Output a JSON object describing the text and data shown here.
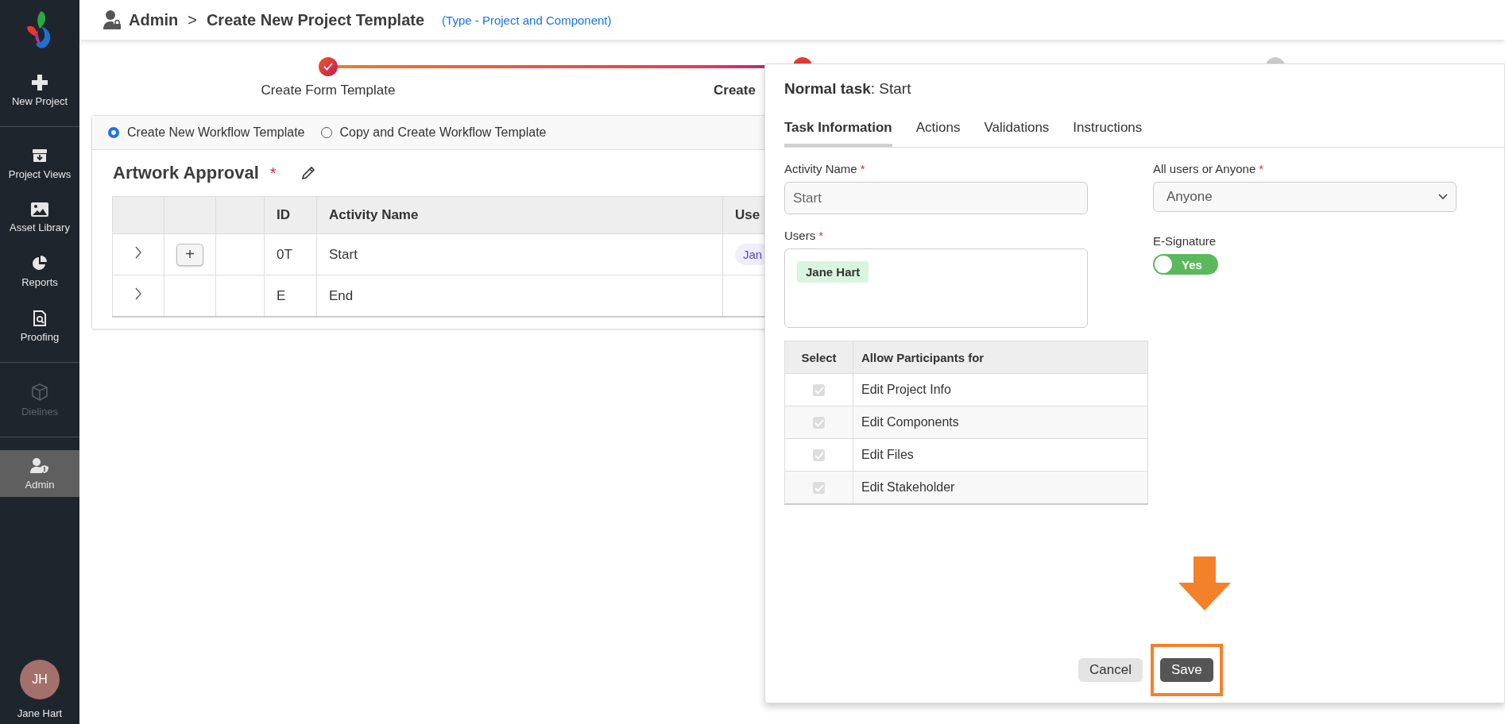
{
  "sidebar": {
    "sections": [
      {
        "items": [
          {
            "label": "New Project",
            "selected": false,
            "disabled": false
          }
        ]
      },
      {
        "items": [
          {
            "label": "Project Views",
            "selected": false,
            "disabled": false
          },
          {
            "label": "Asset Library",
            "selected": false,
            "disabled": false
          },
          {
            "label": "Reports",
            "selected": false,
            "disabled": false
          },
          {
            "label": "Proofing",
            "selected": false,
            "disabled": false
          }
        ]
      },
      {
        "items": [
          {
            "label": "Dielines",
            "selected": false,
            "disabled": true
          }
        ]
      },
      {
        "items": [
          {
            "label": "Admin",
            "selected": true,
            "disabled": false
          }
        ]
      }
    ],
    "user": {
      "initials": "JH",
      "name": "Jane Hart"
    }
  },
  "header": {
    "section": "Admin",
    "separator": ">",
    "title": "Create New Project Template",
    "type_note": "(Type - Project and Component)"
  },
  "stepper": [
    {
      "label": "Create Form Template",
      "kind": "done"
    },
    {
      "label": "Create",
      "kind": "current"
    },
    {
      "kind": "pending"
    }
  ],
  "workflow_options": [
    {
      "label": "Create New Workflow Template",
      "selected": true
    },
    {
      "label": "Copy and Create Workflow Template",
      "selected": false
    }
  ],
  "workflow": {
    "name": "Artwork Approval",
    "required": "*"
  },
  "table": {
    "columns": [
      "",
      "",
      "",
      "ID",
      "Activity Name",
      "Use"
    ],
    "rows": [
      {
        "expanded": false,
        "add_button": "+",
        "id": "0T",
        "activity": "Start",
        "user_chip": "Jan"
      },
      {
        "expanded": false,
        "id": "E",
        "activity": "End"
      }
    ]
  },
  "drawer": {
    "title": "**Normal task**: Start",
    "tabs": [
      {
        "label": "Task Information",
        "selected": true
      },
      {
        "label": "Actions",
        "selected": false
      },
      {
        "label": "Validations",
        "selected": false
      },
      {
        "label": "Instructions",
        "selected": false
      }
    ],
    "activity_name": {
      "label": "Activity Name",
      "required": "*",
      "value": "Start"
    },
    "users": {
      "label": "Users",
      "required": "*",
      "chips": [
        "Jane Hart"
      ]
    },
    "assignment": {
      "label": "All users or Anyone",
      "required": "*",
      "value": "Anyone"
    },
    "esignature": {
      "label": "E-Signature",
      "on": true,
      "text": "Yes"
    },
    "permissions": {
      "columns": [
        "Select",
        "Allow Participants for"
      ],
      "rows": [
        {
          "label": "Edit Project Info",
          "checked": true,
          "disabled": true
        },
        {
          "label": "Edit Components",
          "checked": true,
          "disabled": true
        },
        {
          "label": "Edit Files",
          "checked": true,
          "disabled": true
        },
        {
          "label": "Edit Stakeholder",
          "checked": true,
          "disabled": true
        }
      ]
    },
    "buttons": {
      "cancel": "Cancel",
      "save": "Save"
    }
  }
}
